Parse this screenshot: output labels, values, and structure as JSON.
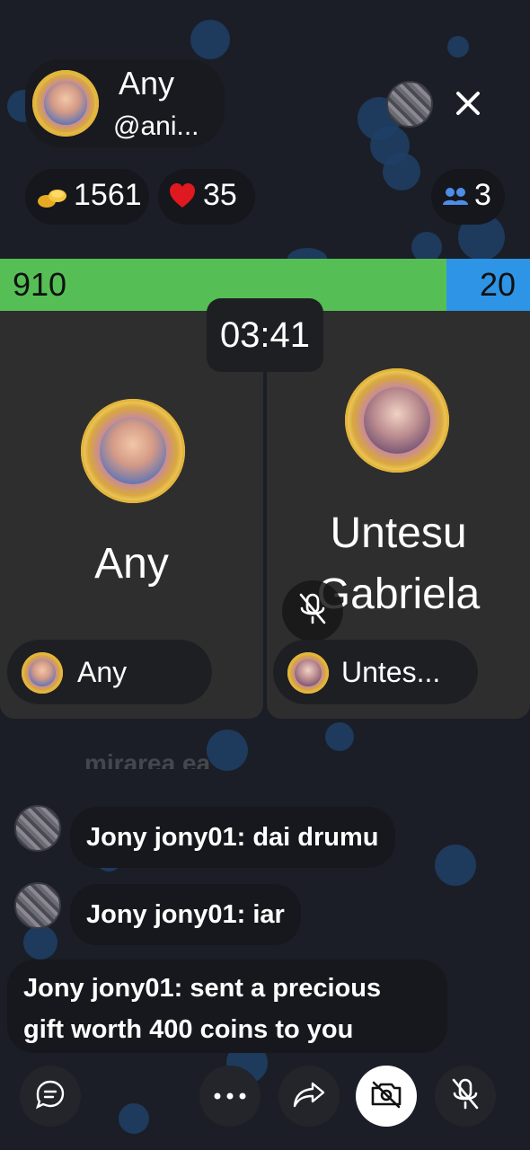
{
  "host": {
    "name": "Any",
    "handle": "@ani..."
  },
  "stats": {
    "coins": "1561",
    "likes": "35",
    "viewers": "3"
  },
  "battle": {
    "left_score": "910",
    "right_score": "20",
    "left_fraction": 0.843,
    "left_color": "#55bf55",
    "right_color": "#2e94e6",
    "timer": "03:41"
  },
  "players": {
    "left": {
      "name": "Any",
      "tag": "Any"
    },
    "right": {
      "name_line1": "Untesu",
      "name_line2": "Gabriela",
      "tag": "Untes..."
    }
  },
  "chat": {
    "faded_message": "mirarea ea",
    "messages": [
      {
        "text": "Jony jony01: dai drumu"
      },
      {
        "text": "Jony jony01: iar"
      }
    ],
    "gift_line1": "Jony jony01: sent a precious",
    "gift_line2": "gift worth 400 coins to you"
  },
  "icons": {
    "close": "close-icon",
    "coins": "coins-icon",
    "heart": "heart-icon",
    "viewers": "users-icon",
    "mic_muted": "mic-off-icon",
    "chat": "chat-icon",
    "more": "more-icon",
    "share": "share-icon",
    "camera_off": "camera-off-icon"
  }
}
